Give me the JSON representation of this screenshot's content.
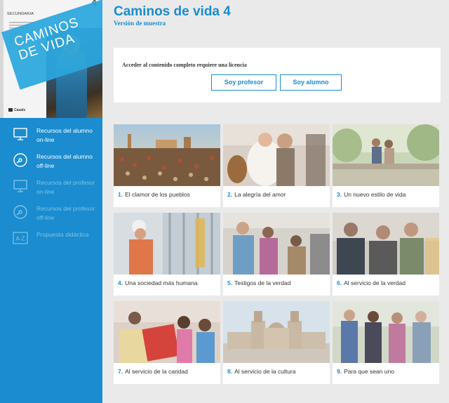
{
  "cover": {
    "edition": "SECUNDARIA",
    "number": "4",
    "title": "CAMINOS DE VIDA",
    "publisher": "Casals"
  },
  "sidebar": {
    "items": [
      {
        "label": "Recursos del alumno on-line",
        "icon": "monitor-icon",
        "enabled": true
      },
      {
        "label": "Recursos del alumno off-line",
        "icon": "disc-icon",
        "enabled": true
      },
      {
        "label": "Recursos del profesor on-line",
        "icon": "monitor-icon",
        "enabled": false
      },
      {
        "label": "Recursos del profesor off-line",
        "icon": "disc-icon",
        "enabled": false
      },
      {
        "label": "Propuesta didáctica",
        "icon": "a-z-icon",
        "enabled": false
      }
    ]
  },
  "header": {
    "title": "Caminos de vida 4",
    "subtitle": "Versión de muestra"
  },
  "license": {
    "message": "Acceder al contenido completo requiere una licencia",
    "professor_button": "Soy profesor",
    "student_button": "Soy alumno"
  },
  "units": [
    {
      "number": "1.",
      "title": "El clamor de los pueblos"
    },
    {
      "number": "2.",
      "title": "La alegría del amor"
    },
    {
      "number": "3.",
      "title": "Un nuevo estilo de vida"
    },
    {
      "number": "4.",
      "title": "Una sociedad más humana"
    },
    {
      "number": "5.",
      "title": "Testigos de la verdad"
    },
    {
      "number": "6.",
      "title": "Al servicio de la verdad"
    },
    {
      "number": "7.",
      "title": "Al servicio de la caridad"
    },
    {
      "number": "8.",
      "title": "Al servicio de la cultura"
    },
    {
      "number": "9.",
      "title": "Para que sean uno"
    }
  ],
  "colors": {
    "accent": "#1a8ccf",
    "sidebar": "#1a8ccf",
    "background": "#eaeaea"
  }
}
